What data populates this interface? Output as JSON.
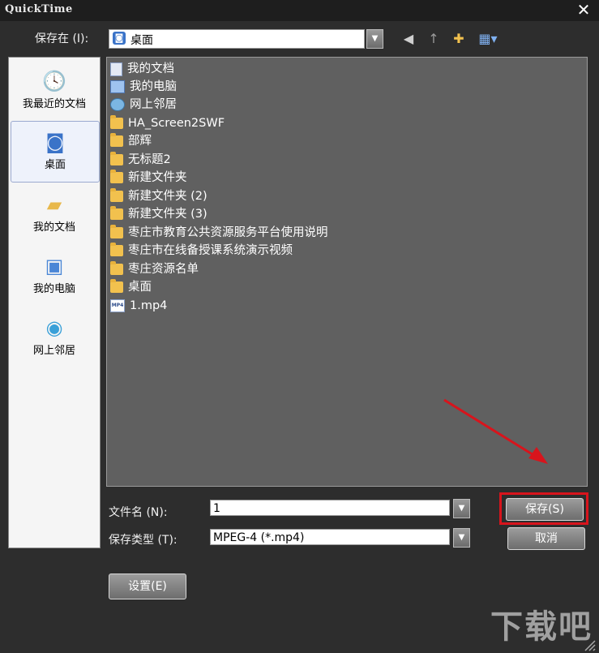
{
  "window": {
    "title": "QuickTime",
    "close_glyph": "✕"
  },
  "save_in": {
    "label": "保存在 (I):",
    "value": "桌面"
  },
  "toolbar": {
    "icons": [
      "back-icon",
      "up-folder-icon",
      "new-folder-icon",
      "view-menu-icon"
    ]
  },
  "places": [
    {
      "label": "我最近的文档",
      "icon": "recent-documents-icon"
    },
    {
      "label": "桌面",
      "icon": "desktop-icon",
      "selected": true
    },
    {
      "label": "我的文档",
      "icon": "my-documents-icon"
    },
    {
      "label": "我的电脑",
      "icon": "my-computer-icon"
    },
    {
      "label": "网上邻居",
      "icon": "network-places-icon"
    }
  ],
  "files": [
    {
      "name": "我的文档",
      "icon": "document-folder-icon"
    },
    {
      "name": "我的电脑",
      "icon": "computer-icon"
    },
    {
      "name": "网上邻居",
      "icon": "network-icon"
    },
    {
      "name": "HA_Screen2SWF",
      "icon": "folder-icon"
    },
    {
      "name": "部辉",
      "icon": "folder-icon"
    },
    {
      "name": "无标题2",
      "icon": "folder-icon"
    },
    {
      "name": "新建文件夹",
      "icon": "folder-icon"
    },
    {
      "name": "新建文件夹 (2)",
      "icon": "folder-icon"
    },
    {
      "name": "新建文件夹 (3)",
      "icon": "folder-icon"
    },
    {
      "name": "枣庄市教育公共资源服务平台使用说明",
      "icon": "folder-icon"
    },
    {
      "name": "枣庄市在线备授课系统演示视频",
      "icon": "folder-icon"
    },
    {
      "name": "枣庄资源名单",
      "icon": "folder-icon"
    },
    {
      "name": "桌面",
      "icon": "folder-icon"
    },
    {
      "name": "1.mp4",
      "icon": "mp4-file-icon"
    }
  ],
  "form": {
    "filename_label": "文件名 (N):",
    "filename_value": "1",
    "filetype_label": "保存类型 (T):",
    "filetype_value": "MPEG-4 (*.mp4)"
  },
  "buttons": {
    "save": "保存(S)",
    "cancel": "取消",
    "settings": "设置(E)"
  },
  "colors": {
    "highlight": "#d8141c",
    "arrow": "#d8141c"
  },
  "watermark": "下载吧"
}
